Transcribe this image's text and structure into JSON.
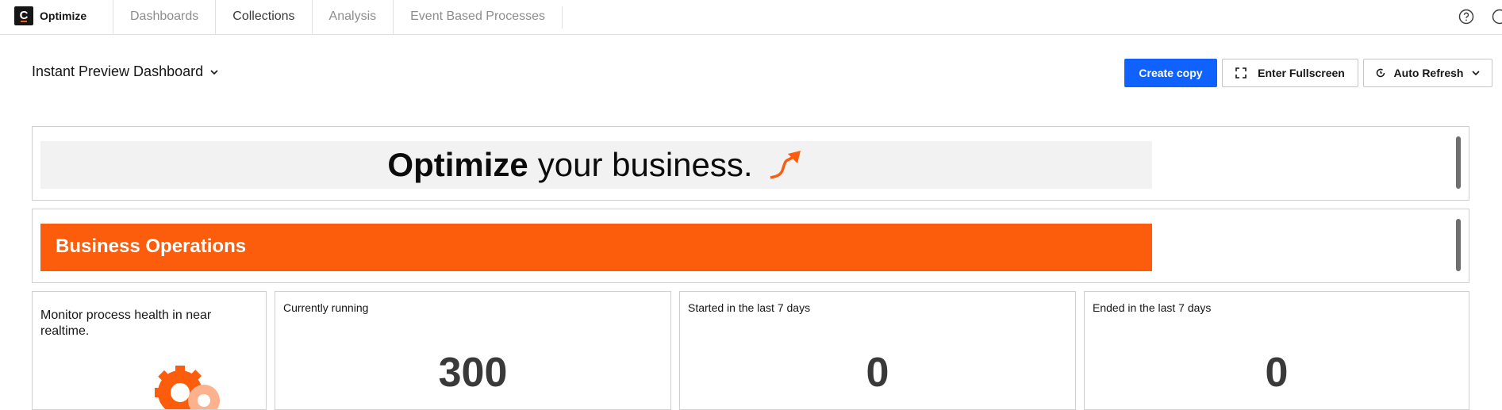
{
  "app": {
    "logo_letter": "C",
    "name": "Optimize"
  },
  "nav": {
    "items": [
      "Dashboards",
      "Collections",
      "Analysis",
      "Event Based Processes"
    ]
  },
  "header": {
    "dashboard_title": "Instant Preview Dashboard",
    "create_copy": "Create copy",
    "fullscreen": "Enter Fullscreen",
    "auto_refresh": "Auto Refresh"
  },
  "banners": {
    "optimize_bold": "Optimize",
    "optimize_rest": "your business.",
    "business_operations": "Business Operations"
  },
  "tiles": {
    "description": "Monitor process health in near realtime.",
    "kpis": [
      {
        "title": "Currently running",
        "value": "300"
      },
      {
        "title": "Started in the last 7 days",
        "value": "0"
      },
      {
        "title": "Ended in the last 7 days",
        "value": "0"
      }
    ]
  },
  "colors": {
    "accent": "#fc5d0d",
    "primary": "#0f62fe"
  },
  "icons": [
    "help-icon",
    "user-icon",
    "chevron-down-icon",
    "fullscreen-icon",
    "refresh-icon",
    "arrow-up-icon",
    "gear-icon"
  ]
}
